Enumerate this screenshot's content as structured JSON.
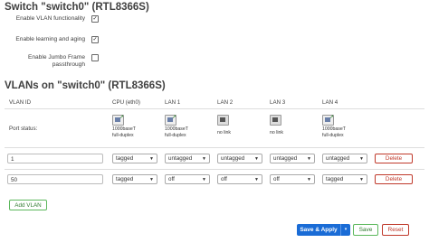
{
  "switch_section": {
    "title": "Switch \"switch0\" (RTL8366S)",
    "options": [
      {
        "label": "Enable VLAN functionality",
        "checked": true
      },
      {
        "label": "Enable learning and aging",
        "checked": true
      },
      {
        "label": "Enable Jumbo Frame passthrough",
        "checked": false
      }
    ]
  },
  "vlan_section": {
    "title": "VLANs on \"switch0\" (RTL8366S)",
    "headers": [
      "VLAN ID",
      "CPU (eth0)",
      "LAN 1",
      "LAN 2",
      "LAN 3",
      "LAN 4"
    ],
    "port_status_label": "Port status:",
    "port_status": [
      {
        "line1": "1000baseT",
        "line2": "full-duplex",
        "link": true
      },
      {
        "line1": "1000baseT",
        "line2": "full-duplex",
        "link": true
      },
      {
        "line1": "no link",
        "line2": "",
        "link": false
      },
      {
        "line1": "no link",
        "line2": "",
        "link": false
      },
      {
        "line1": "1000baseT",
        "line2": "full-duplex",
        "link": true
      }
    ],
    "rows": [
      {
        "vlan_id": "1",
        "ports": [
          "tagged",
          "untagged",
          "untagged",
          "untagged",
          "untagged"
        ],
        "delete_label": "Delete"
      },
      {
        "vlan_id": "50",
        "ports": [
          "tagged",
          "off",
          "off",
          "off",
          "tagged"
        ],
        "delete_label": "Delete"
      }
    ],
    "add_label": "Add VLAN"
  },
  "footer": {
    "save_apply_label": "Save & Apply",
    "split_caret": "▾",
    "save_label": "Save",
    "reset_label": "Reset"
  }
}
